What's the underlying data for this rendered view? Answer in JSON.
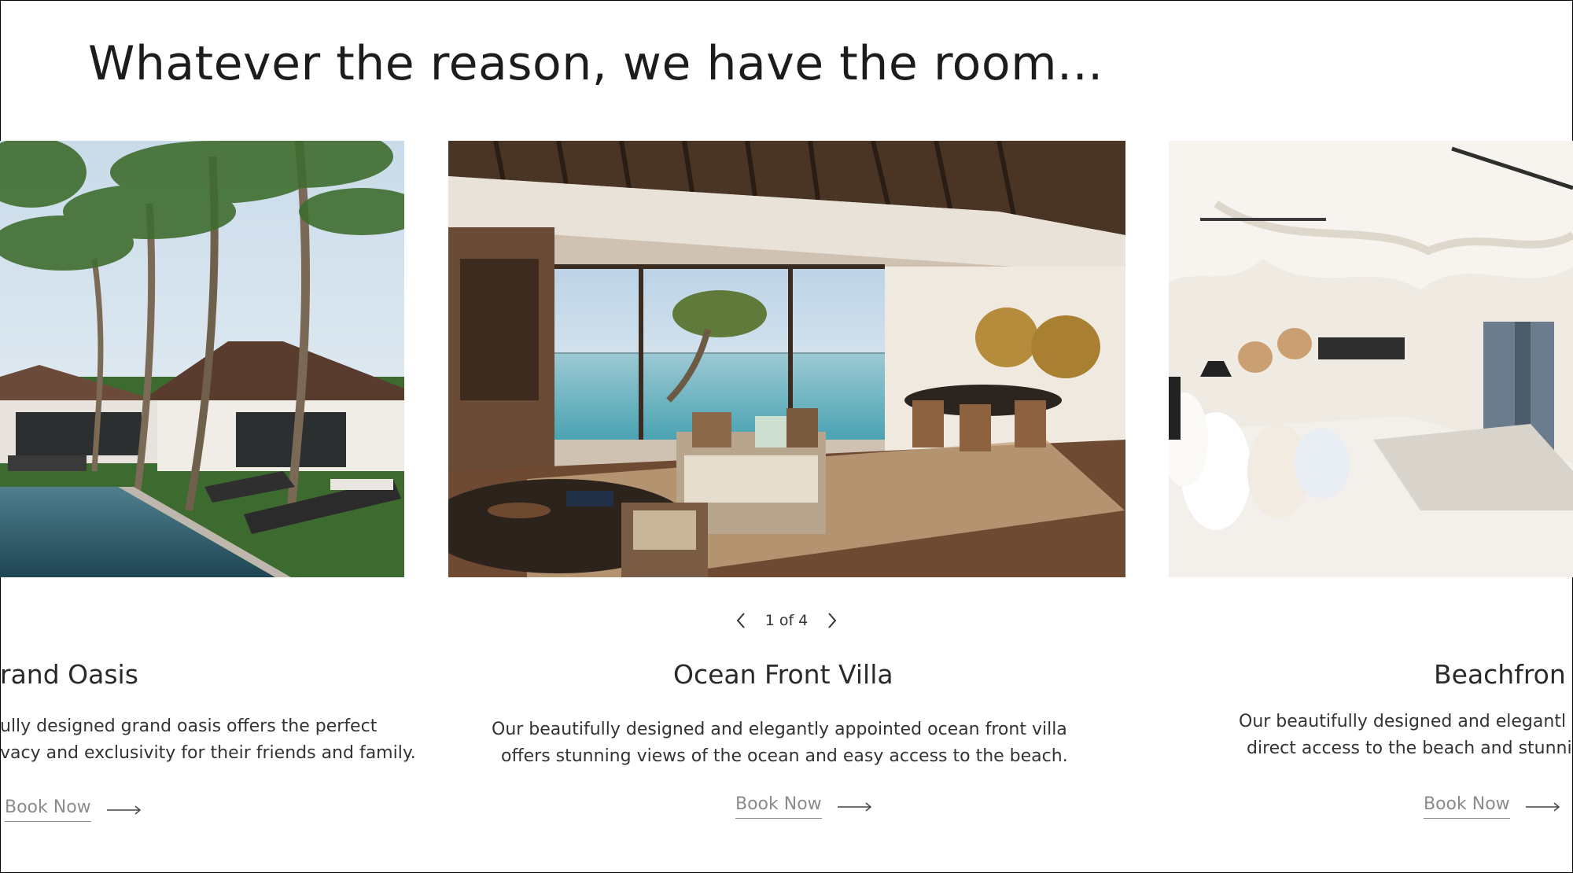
{
  "heading": "Whatever the reason, we have the room...",
  "pager": {
    "text": "1 of 4",
    "prev_icon": "chevron-left-icon",
    "next_icon": "chevron-right-icon"
  },
  "cards": [
    {
      "title": "rand Oasis",
      "desc_lines": [
        "ully designed grand oasis offers the perfect",
        "vacy and exclusivity for their friends and family."
      ],
      "cta": "Book Now"
    },
    {
      "title": "Ocean Front Villa",
      "desc_lines": [
        "Our beautifully designed and elegantly appointed ocean front villa",
        "offers stunning views of the ocean and easy access to the beach."
      ],
      "cta": "Book Now"
    },
    {
      "title": "Beachfron",
      "desc_lines": [
        "Our beautifully designed and elegantl",
        "direct access to the beach and stunni"
      ],
      "cta": "Book Now"
    }
  ],
  "colors": {
    "text": "#222222",
    "muted": "#8b8b8b",
    "background": "#ffffff"
  }
}
